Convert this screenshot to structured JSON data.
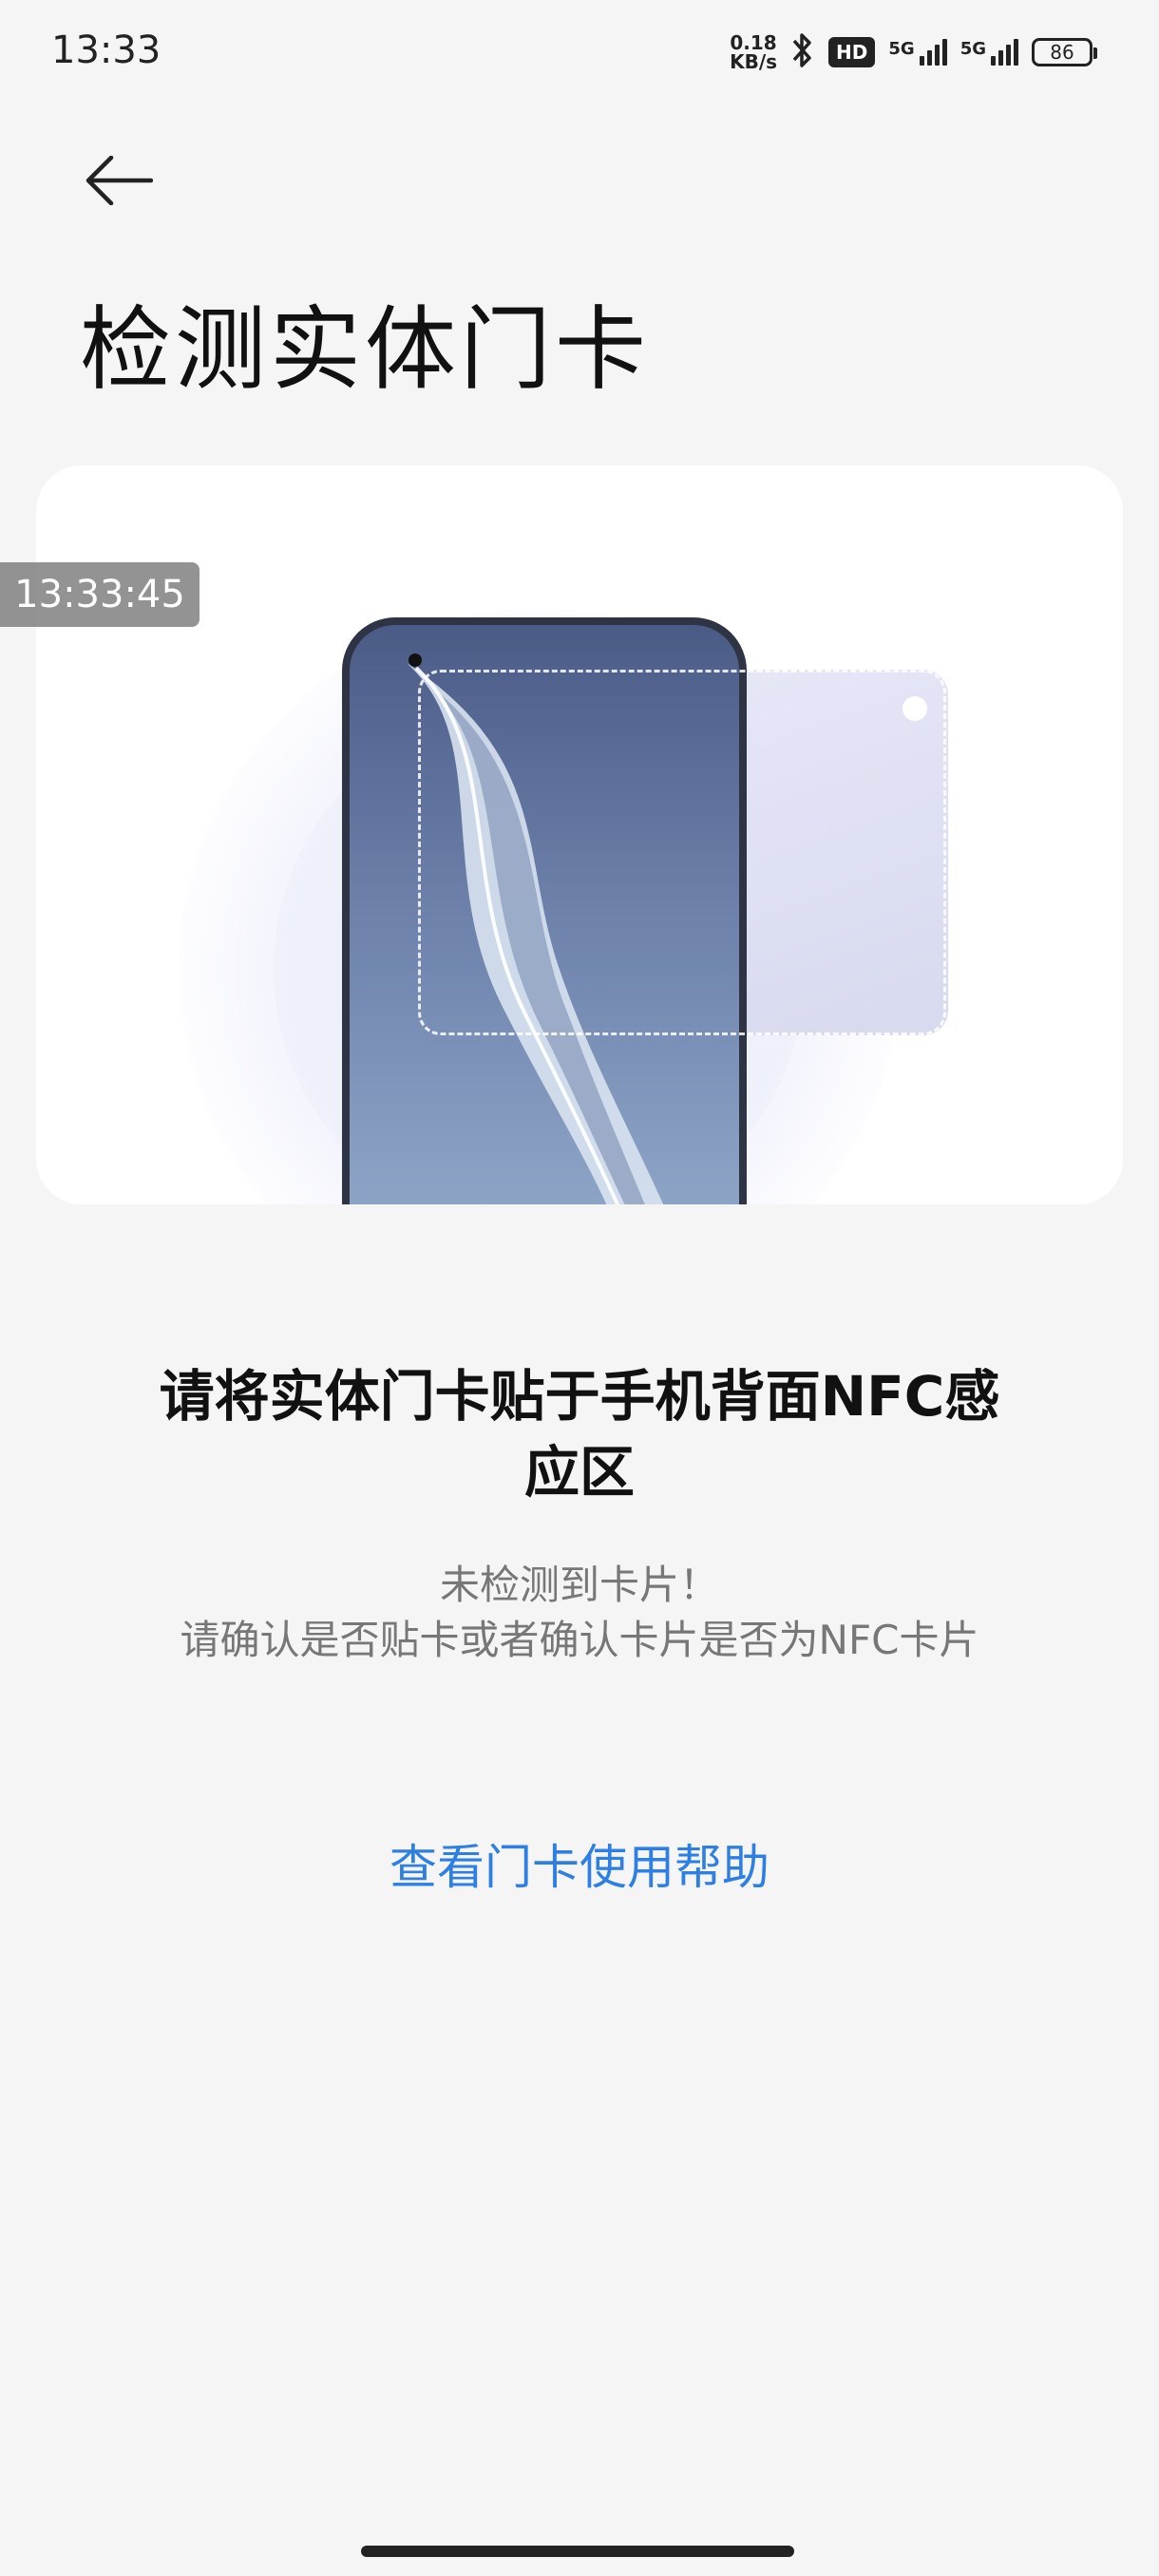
{
  "status_bar": {
    "time": "13:33",
    "net_speed_value": "0.18",
    "net_speed_unit": "KB/s",
    "hd_label": "HD",
    "sim1_label": "5G",
    "sim2_label": "5G",
    "battery": "86"
  },
  "overlay_timestamp": "13:33:45",
  "page": {
    "title": "检测实体门卡"
  },
  "instruction": {
    "line1": "请将实体门卡贴于手机背面NFC感",
    "line2": "应区"
  },
  "status": {
    "line1": "未检测到卡片！",
    "line2": "请确认是否贴卡或者确认卡片是否为NFC卡片"
  },
  "help_link": "查看门卡使用帮助",
  "colors": {
    "accent": "#2e7fe3",
    "background": "#f5f5f5"
  },
  "icons": {
    "back": "back-arrow-icon",
    "bluetooth": "bluetooth-icon"
  }
}
